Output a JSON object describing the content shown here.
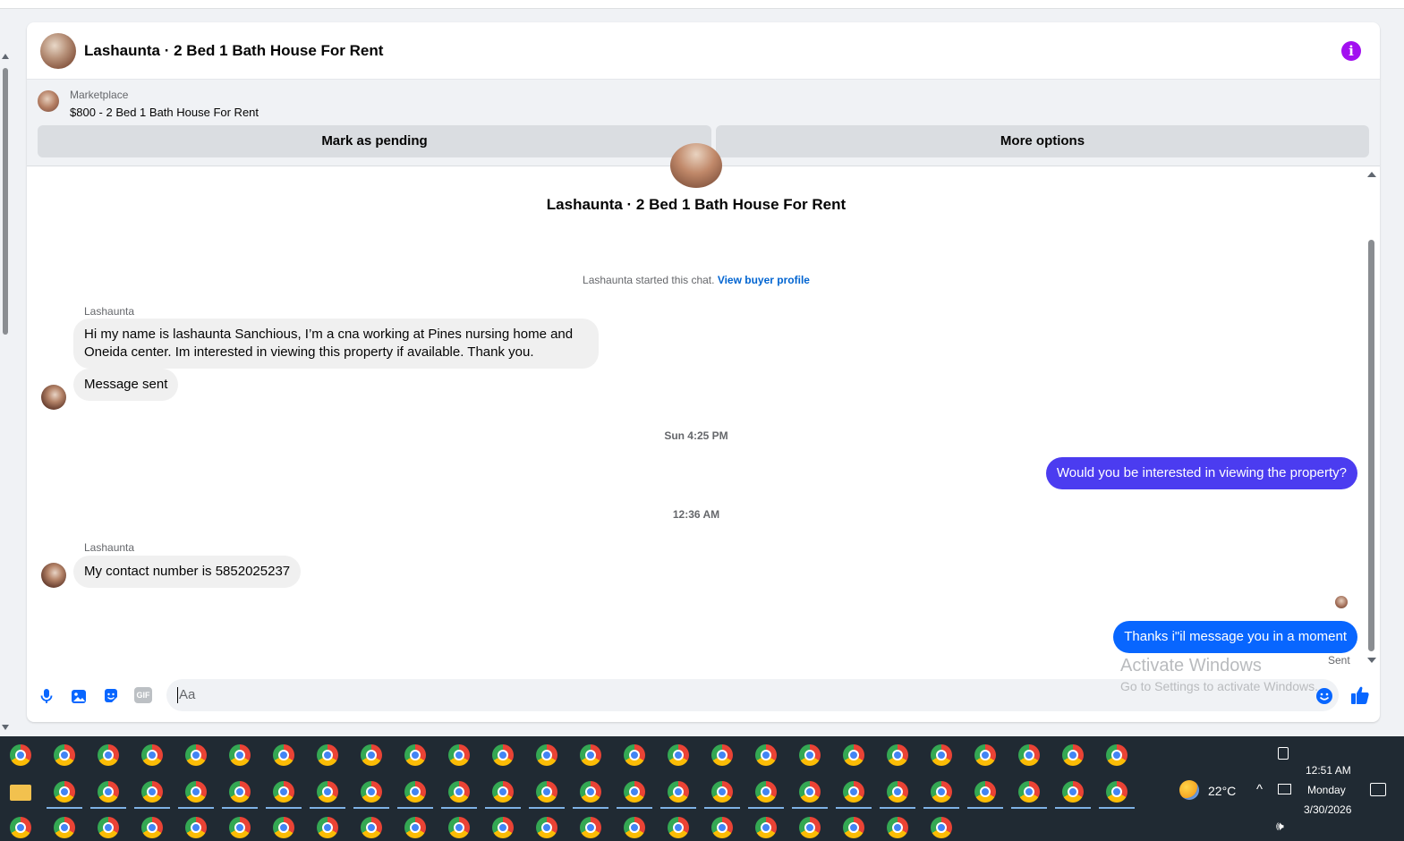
{
  "header": {
    "title": "Lashaunta · 2 Bed 1 Bath House For Rent",
    "info_icon": "info-icon"
  },
  "listing": {
    "category": "Marketplace",
    "price_title": "$800 - 2 Bed 1 Bath House For Rent",
    "mark_pending_label": "Mark as pending",
    "more_options_label": "More options"
  },
  "conversation": {
    "title": "Lashaunta · 2 Bed 1 Bath House For Rent",
    "started_text": "Lashaunta started this chat.",
    "view_profile_link": "View buyer profile",
    "messages": [
      {
        "sender": "Lashaunta",
        "text": "Hi my name is lashaunta Sanchious, I’m a cna working at Pines nursing home and Oneida center. Im interested in viewing this property if available. Thank you.",
        "direction": "in"
      },
      {
        "text": "Message sent",
        "direction": "in"
      },
      {
        "timestamp": "Sun 4:25 PM"
      },
      {
        "text": "Would you be interested in viewing the property?",
        "direction": "out",
        "color": "#4b3cf0"
      },
      {
        "timestamp": "12:36 AM"
      },
      {
        "sender": "Lashaunta",
        "text": "My contact number is 5852025237",
        "direction": "in"
      },
      {
        "text": "Thanks i\"il message you in a moment",
        "direction": "out",
        "color": "#0866ff"
      }
    ],
    "sent_status": "Sent"
  },
  "composer": {
    "placeholder": "Aa",
    "icons": [
      "microphone-icon",
      "photo-icon",
      "sticker-icon",
      "gif-icon",
      "emoji-icon",
      "thumbs-up-icon"
    ],
    "gif_label": "GIF",
    "accent": "#0866ff"
  },
  "watermark": {
    "line1": "Activate Windows",
    "line2": "Go to Settings to activate Windows."
  },
  "taskbar": {
    "weather": "22°C",
    "time": "12:51 AM",
    "day": "Monday",
    "date": "3/30/2026",
    "bg": "#202a33"
  }
}
